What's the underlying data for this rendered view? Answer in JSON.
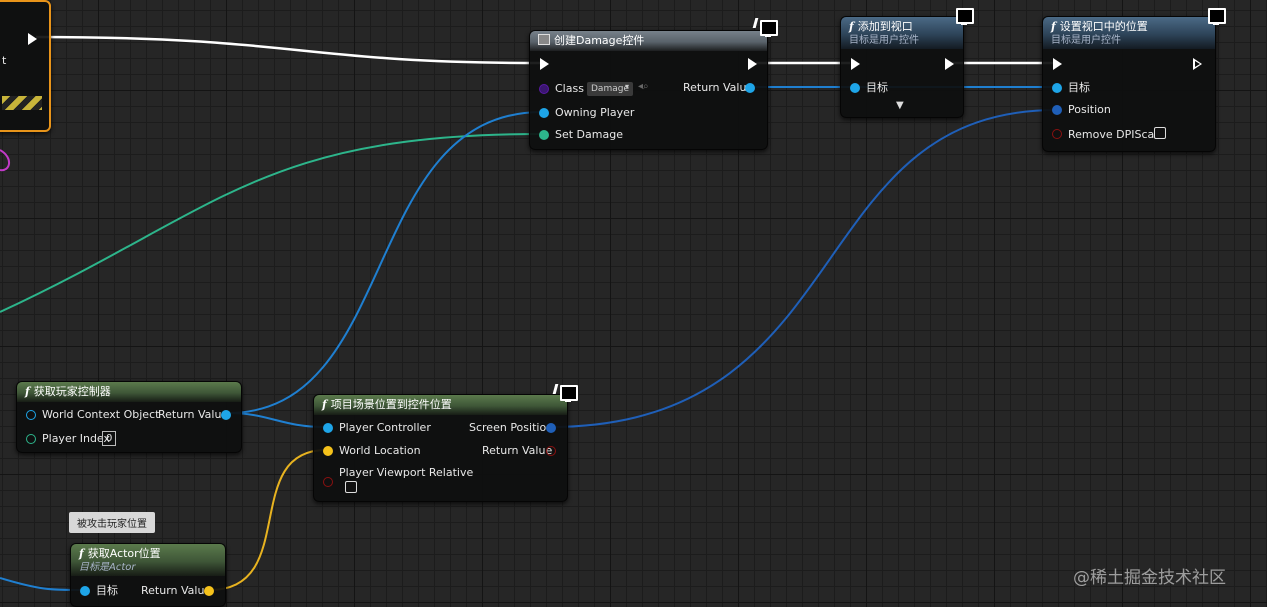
{
  "nodes": {
    "create_widget": {
      "title": "创建Damage控件",
      "class_label": "Class",
      "class_value": "Damage",
      "return_label": "Return Value",
      "owning_label": "Owning Player",
      "set_damage_label": "Set Damage"
    },
    "add_to_viewport": {
      "title": "添加到视口",
      "subtitle": "目标是用户控件",
      "target_label": "目标"
    },
    "set_position": {
      "title": "设置视口中的位置",
      "subtitle": "目标是用户控件",
      "target_label": "目标",
      "position_label": "Position",
      "remove_dpi_label": "Remove DPIScale"
    },
    "get_player_controller": {
      "title": "获取玩家控制器",
      "world_label": "World Context Object",
      "return_label": "Return Value",
      "index_label": "Player Index",
      "index_value": "0"
    },
    "project_world": {
      "title": "项目场景位置到控件位置",
      "controller_label": "Player Controller",
      "screen_label": "Screen Position",
      "world_loc_label": "World Location",
      "return_label": "Return Value",
      "relative_label": "Player Viewport Relative"
    },
    "get_actor_location": {
      "title": "获取Actor位置",
      "subtitle": "目标是Actor",
      "target_label": "目标",
      "return_label": "Return Value"
    }
  },
  "comment": {
    "text": "被攻击玩家位置"
  },
  "partial_left": {
    "label": "t"
  },
  "watermark": "@稀土掘金技术社区",
  "colors": {
    "exec": "#ffffff",
    "object_pin": "#1ea5e8",
    "struct_pin": "#1f8e6e",
    "vector_pin": "#f5c21b",
    "class_pin": "#5a1aa6",
    "wire_blue": "#1f7fd0",
    "wire_green": "#2db58b",
    "wire_yellow": "#e8b320",
    "accent_orange": "#e89a1c"
  }
}
